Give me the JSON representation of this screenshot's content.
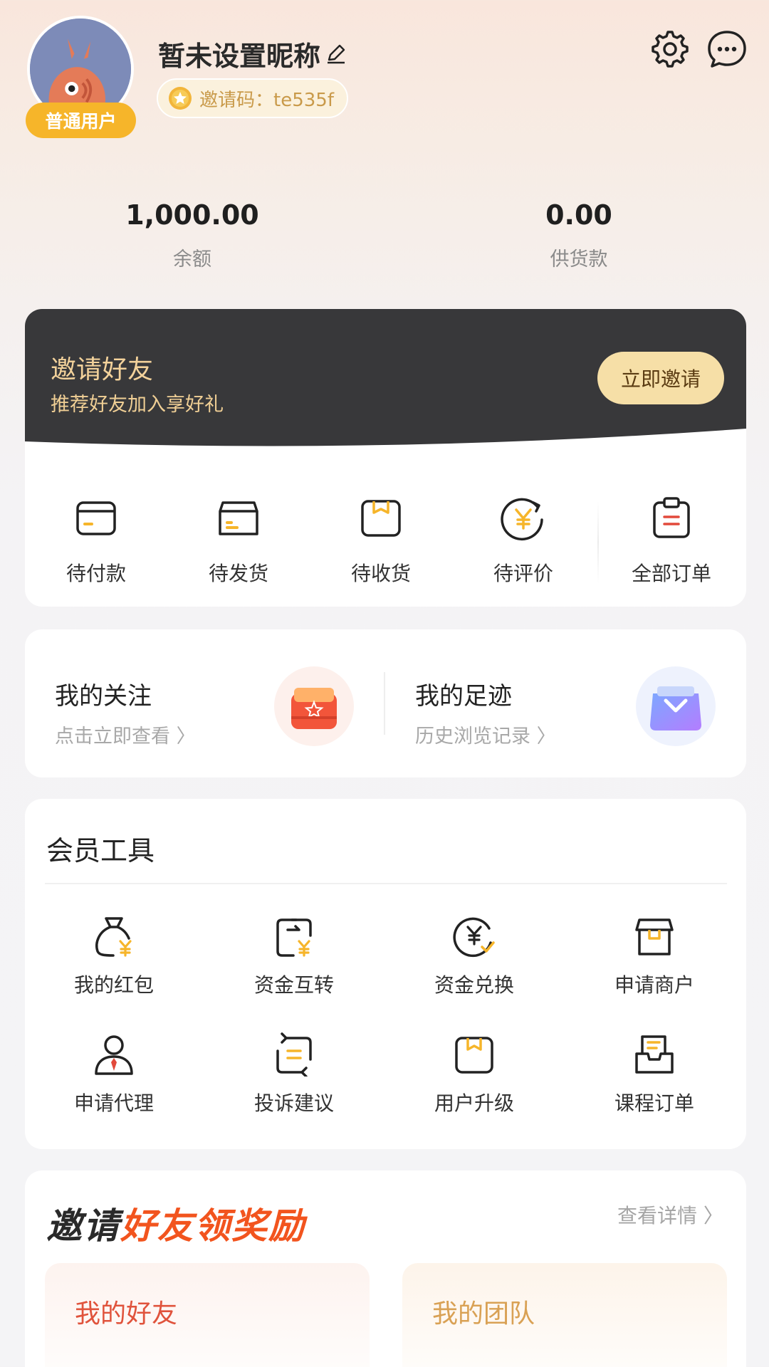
{
  "profile": {
    "nickname": "暂未设置昵称",
    "level_badge": "普通用户",
    "invite_code": "邀请码：te535f"
  },
  "stats": [
    {
      "value": "1,000.00",
      "label": "余额"
    },
    {
      "value": "0.00",
      "label": "供货款"
    }
  ],
  "invite_banner": {
    "title": "邀请好友",
    "subtitle": "推荐好友加入享好礼",
    "button": "立即邀请"
  },
  "orders": [
    {
      "label": "待付款",
      "icon": "wallet-icon"
    },
    {
      "label": "待发货",
      "icon": "box-icon"
    },
    {
      "label": "待收货",
      "icon": "package-icon"
    },
    {
      "label": "待评价",
      "icon": "yen-refresh-icon"
    },
    {
      "label": "全部订单",
      "icon": "clipboard-icon"
    }
  ],
  "follow": {
    "left": {
      "title": "我的关注",
      "sub": "点击立即查看 〉"
    },
    "right": {
      "title": "我的足迹",
      "sub": "历史浏览记录 〉"
    }
  },
  "tools": {
    "title": "会员工具",
    "items": [
      {
        "label": "我的红包",
        "icon": "money-bag-icon"
      },
      {
        "label": "资金互转",
        "icon": "transfer-icon"
      },
      {
        "label": "资金兑换",
        "icon": "exchange-icon"
      },
      {
        "label": "申请商户",
        "icon": "shop-icon"
      },
      {
        "label": "申请代理",
        "icon": "agent-icon"
      },
      {
        "label": "投诉建议",
        "icon": "feedback-icon"
      },
      {
        "label": "用户升级",
        "icon": "upgrade-icon"
      },
      {
        "label": "课程订单",
        "icon": "course-icon"
      }
    ]
  },
  "rewards": {
    "title_dark": "邀请",
    "title_red": "好友领奖励",
    "more": "查看详情 〉",
    "boxes": [
      "我的好友",
      "我的团队"
    ]
  },
  "colors": {
    "accent": "#f6b52a",
    "banner_bg": "#38383a",
    "banner_text": "#f3d29b",
    "red": "#f2541e"
  }
}
